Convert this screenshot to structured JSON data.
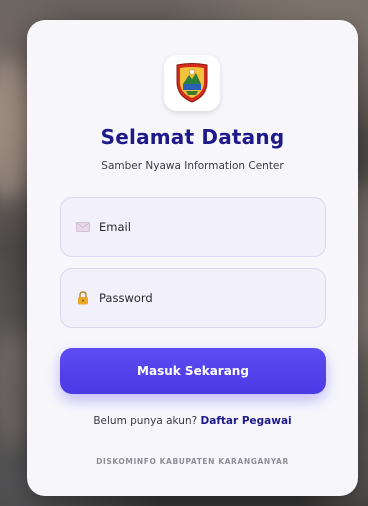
{
  "header": {
    "title": "Selamat Datang",
    "subtitle": "Samber Nyawa Information Center"
  },
  "form": {
    "email_placeholder": "Email",
    "password_placeholder": "Password",
    "submit_label": "Masuk Sekarang"
  },
  "register": {
    "prompt": "Belum punya akun?",
    "link_label": "Daftar Pegawai"
  },
  "footer": {
    "text": "DISKOMINFO KABUPATEN KARANGANYAR"
  },
  "icons": {
    "logo": "karanganyar-emblem-icon",
    "email": "envelope-icon",
    "password": "lock-icon"
  },
  "colors": {
    "accent": "#4b39e6",
    "title": "#1f1a8a",
    "card_bg": "#f7f7fb",
    "field_bg": "#f2f1fb"
  }
}
